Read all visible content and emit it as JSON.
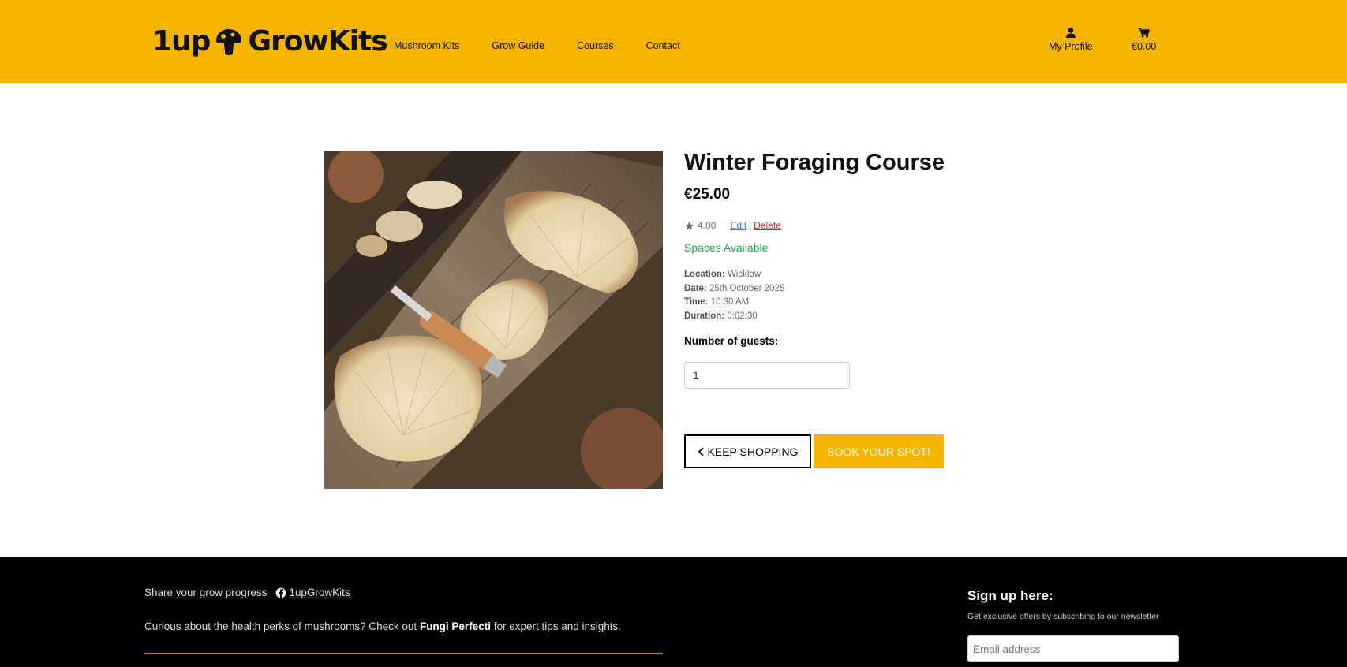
{
  "header": {
    "logo_left": "1up",
    "logo_right": "GrowKits",
    "nav": [
      {
        "label": "Mushroom Kits"
      },
      {
        "label": "Grow Guide"
      },
      {
        "label": "Courses"
      },
      {
        "label": "Contact"
      }
    ],
    "profile_label": "My Profile",
    "cart_total": "€0.00"
  },
  "product": {
    "title": "Winter Foraging Course",
    "price": "€25.00",
    "rating": "4.00",
    "edit_label": "Edit",
    "separator": "|",
    "delete_label": "Delete",
    "availability": "Spaces Available",
    "details": {
      "location_label": "Location:",
      "location": "Wicklow",
      "date_label": "Date:",
      "date": "25th October 2025",
      "time_label": "Time:",
      "time": "10:30 AM",
      "duration_label": "Duration:",
      "duration": "0:02:30"
    },
    "guests_label": "Number of guests:",
    "guests_value": "1",
    "keep_shopping_label": "KEEP SHOPPING",
    "book_label": "BOOK YOUR SPOT!"
  },
  "footer": {
    "share_text": "Share your grow progress",
    "facebook_handle": "1upGrowKits",
    "curious_before": "Curious about the health perks of mushrooms? Check out ",
    "curious_link": "Fungi Perfecti",
    "curious_after": " for expert tips and insights.",
    "signup_title": "Sign up here:",
    "signup_subtitle": "Get exclusive offers by subscribing to our newsletter",
    "email_placeholder": "Email address"
  },
  "colors": {
    "brand_yellow": "#f5b400",
    "available_green": "#22a447",
    "edit_blue": "#2a7ad6",
    "delete_red": "#cc2222"
  }
}
